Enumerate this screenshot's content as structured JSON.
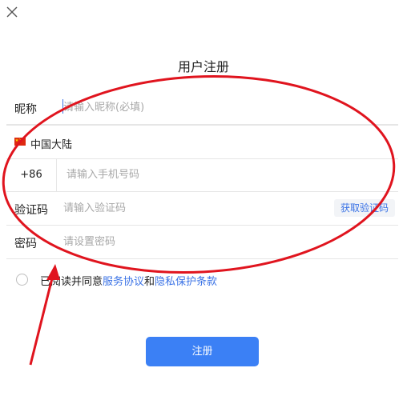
{
  "header": {
    "close_icon": "close-icon",
    "title": "用户注册"
  },
  "form": {
    "nickname": {
      "label": "昵称",
      "placeholder": "请输入昵称(必填)",
      "value": ""
    },
    "region": {
      "flag_icon": "china-flag-icon",
      "name": "中国大陆"
    },
    "phone": {
      "country_code": "+86",
      "placeholder": "请输入手机号码",
      "value": ""
    },
    "verify_code": {
      "label": "验证码",
      "placeholder": "请输入验证码",
      "value": "",
      "get_code_label": "获取验证码"
    },
    "password": {
      "label": "密码",
      "placeholder": "请设置密码",
      "value": ""
    }
  },
  "agreement": {
    "checked": false,
    "prefix": "已阅读并同意",
    "service_link": "服务协议",
    "joiner": "和",
    "privacy_link": "隐私保护条款"
  },
  "actions": {
    "register_label": "注册"
  },
  "colors": {
    "accent": "#3b80f5",
    "link": "#3b73e6",
    "annotation": "#e0141e"
  }
}
